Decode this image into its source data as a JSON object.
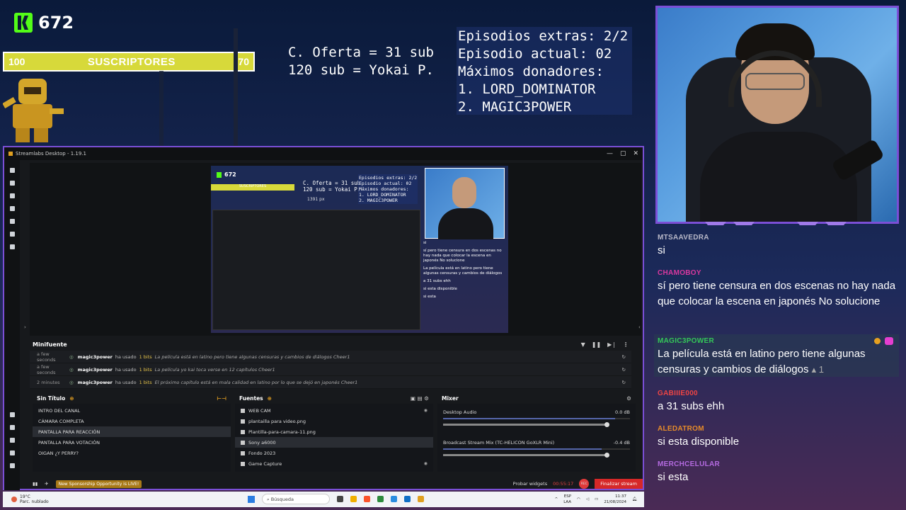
{
  "overlay": {
    "kick_count": "672",
    "sub_bar": {
      "left": "100",
      "label": "SUSCRIPTORES",
      "right": "70"
    },
    "offer_lines": [
      "C. Oferta = 31 sub",
      "120 sub = Yokai P."
    ],
    "episodes_lines": [
      "Episodios extras: 2/2",
      "Episodio actual: 02",
      "Máximos donadores:",
      "1. LORD_DOMINATOR",
      "2. MAGIC3POWER"
    ]
  },
  "chat": {
    "messages": [
      {
        "user": "MTSAAVEDRA",
        "user_color": "#b8b8c8",
        "text": "si"
      },
      {
        "user": "CHAMOBOY",
        "user_color": "#d9389f",
        "text": "sí pero tiene censura en dos escenas no hay nada que colocar la escena en japonés No solucione"
      },
      {
        "user": "MAGIC3POWER",
        "user_color": "#34c759",
        "text": "La película está en latino pero tiene algunas censuras y cambios de diálogos",
        "likes": "1"
      },
      {
        "user": "GABIIIE000",
        "user_color": "#e44",
        "text": "a 31 subs ehh"
      },
      {
        "user": "ALEDATROM",
        "user_color": "#e58b2a",
        "text": "si esta disponible"
      },
      {
        "user": "MERCHCELULAR",
        "user_color": "#b46ae0",
        "text": "si esta"
      }
    ]
  },
  "streamlabs": {
    "title": "Streamlabs Desktop - 1.19.1",
    "preview": {
      "kick_count": "672",
      "sub_label": "SUSCRIPTORES",
      "offer": "C. Oferta = 31 sub\n120 sub = Yokai P.",
      "episodes": "Episodios extras: 2/2\nEpisodio actual: 02\nMáximos donadores:\n1. LORD_DOMINATOR\n2. MAGIC3POWER",
      "dimension": "1391 px",
      "chat": [
        "si",
        "sí pero tiene censura en dos escenas no hay nada que colocar la escena en japonés No solucione",
        "La película está en latino pero tiene algunas censuras y cambios de diálogos",
        "a 31 subs ehh",
        "si esta disponible",
        "si esta"
      ]
    },
    "minifuente": {
      "title": "Minifuente",
      "events": [
        {
          "time": "a few seconds",
          "user": "magic3power",
          "action": "ha usado",
          "bits": "1 bits",
          "message": "La película está en latino pero tiene algunas censuras y cambios de diálogos Cheer1"
        },
        {
          "time": "a few seconds",
          "user": "magic3power",
          "action": "ha usado",
          "bits": "1 bits",
          "message": "La película yo kai toca verse en 12 capítulos Cheer1"
        },
        {
          "time": "2 minutes",
          "user": "magic3power",
          "action": "ha usado",
          "bits": "1 bits",
          "message": "El próximo capítulo está en mala calidad en latino por lo que se dejó en japonés Cheer1"
        }
      ]
    },
    "scenes": {
      "title": "Sin Título",
      "items": [
        "INTRO DEL CANAL",
        "CÁMARA COMPLETA",
        "PANTALLA PARA REACCIÓN",
        "PANTALLA PARA VOTACIÓN",
        "OIGAN ¿Y PERRY?"
      ],
      "selected": 2
    },
    "sources": {
      "title": "Fuentes",
      "items": [
        "WEB CAM",
        "plantailla para video.png",
        "Plantilla-para-camara-11.png",
        "Sony a6000",
        "Fondo 2023",
        "Game Capture"
      ],
      "selected": 3
    },
    "mixer": {
      "title": "Mixer",
      "channels": [
        {
          "name": "Desktop Audio",
          "db": "0.0 dB"
        },
        {
          "name": "Broadcast Stream Mix (TC-HELICON GoXLR Mini)",
          "db": "-0.4 dB"
        }
      ]
    },
    "footer": {
      "sponsor": "New Sponsorship Opportunity is LIVE!",
      "widgets": "Probar widgets",
      "timer": "00:55:17",
      "rec": "REC",
      "end": "Finalizar stream"
    }
  },
  "taskbar": {
    "weather_temp": "19°C",
    "weather_desc": "Parc. nublado",
    "search": "Búsqueda",
    "lang": "ESP\nLAA",
    "time": "11:37",
    "date": "21/08/2024"
  }
}
